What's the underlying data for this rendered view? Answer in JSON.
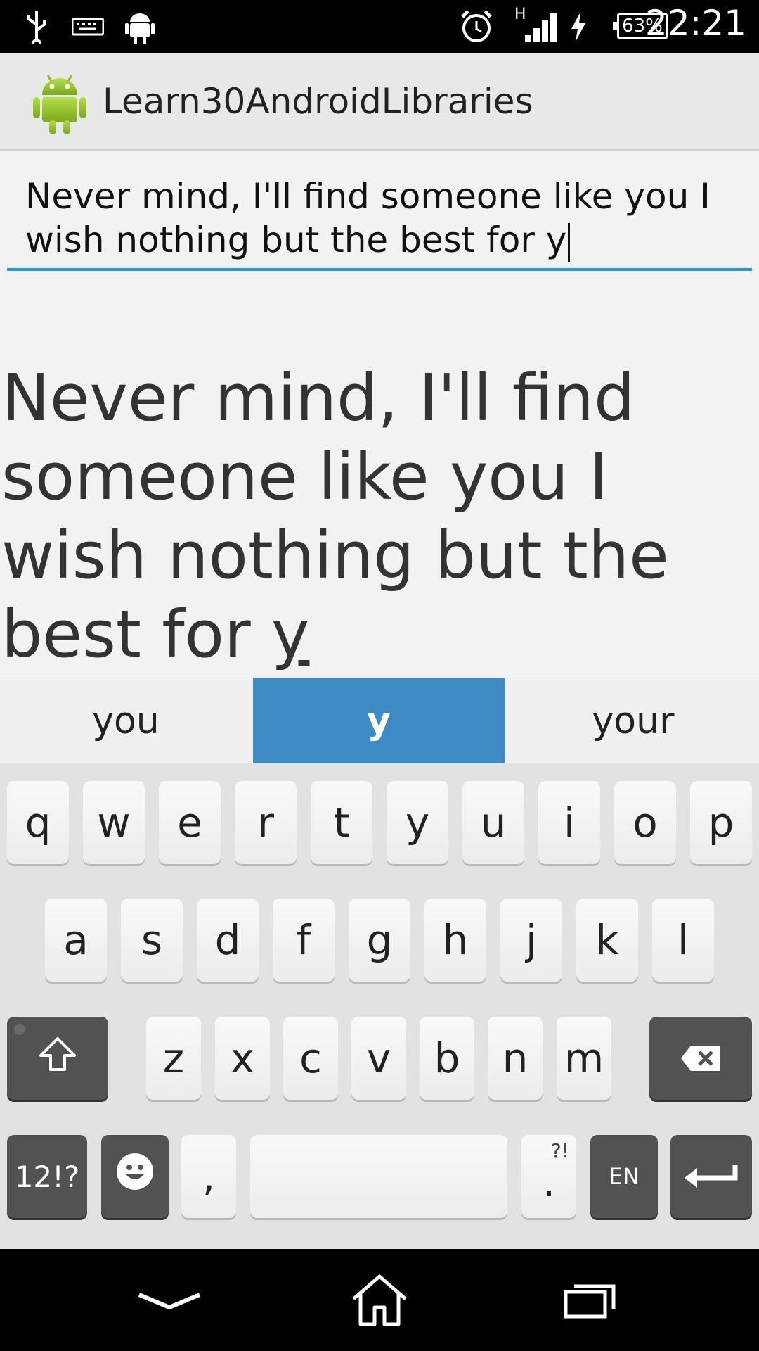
{
  "status_bar": {
    "time": "22:21",
    "battery": "63%",
    "network_type": "H",
    "left_icons": [
      "usb-icon",
      "keyboard-icon",
      "android-debug-icon"
    ],
    "right_icons": [
      "alarm-icon",
      "signal-icon",
      "charging-icon",
      "battery-icon"
    ]
  },
  "action_bar": {
    "title": "Learn30AndroidLibraries",
    "icon": "android-robot-icon"
  },
  "edit_text": {
    "value": "Never mind, I'll find someone like you  I wish nothing but the best for y"
  },
  "display_text": {
    "main": "Never mind, I'll find someone like you  I wish nothing but the best for ",
    "composing": "y"
  },
  "suggestions": [
    "you",
    "y",
    "your"
  ],
  "keyboard": {
    "row1": [
      "q",
      "w",
      "e",
      "r",
      "t",
      "y",
      "u",
      "i",
      "o",
      "p"
    ],
    "row2": [
      "a",
      "s",
      "d",
      "f",
      "g",
      "h",
      "j",
      "k",
      "l"
    ],
    "row3": [
      "z",
      "x",
      "c",
      "v",
      "b",
      "n",
      "m"
    ],
    "shift_icon": "shift-icon",
    "backspace_icon": "backspace-icon",
    "symbols_label": "12!?",
    "emoji_icon": "emoji-icon",
    "comma_label": ",",
    "period_label": ".",
    "period_hint": "?!",
    "language_label": "EN",
    "enter_icon": "enter-icon"
  },
  "nav_bar": {
    "icons": [
      "back-icon",
      "home-icon",
      "recents-icon"
    ]
  }
}
